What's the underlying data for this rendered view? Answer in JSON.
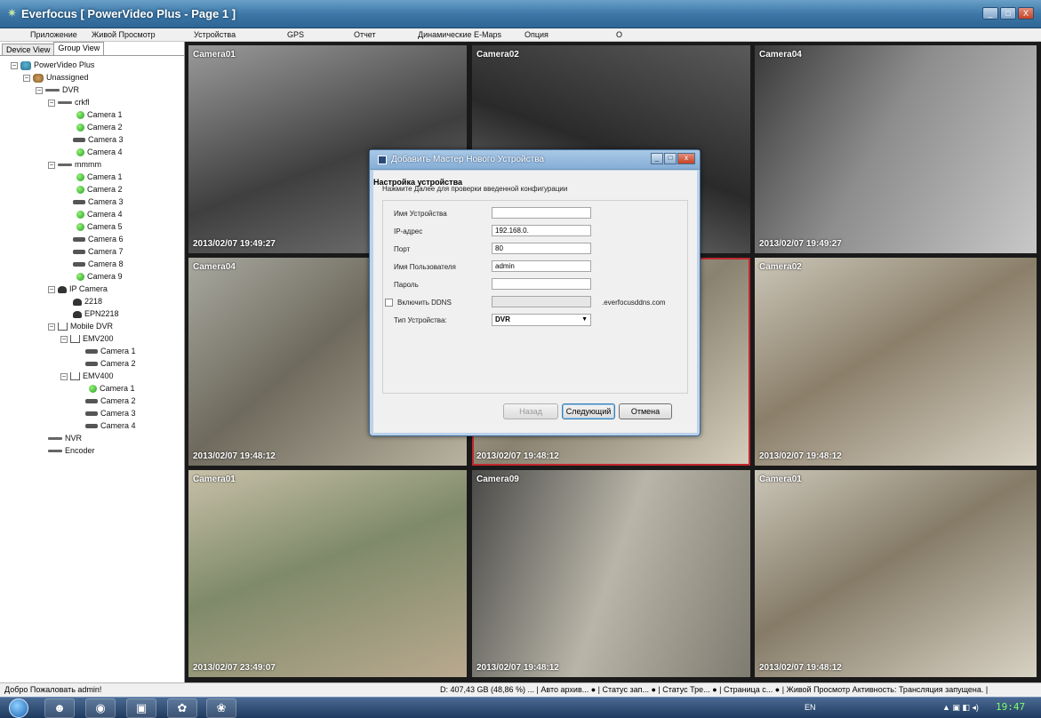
{
  "window": {
    "title": "Everfocus  [ PowerVideo Plus - Page 1 ]",
    "controls": [
      "_",
      "□",
      "X"
    ]
  },
  "menu": [
    "Приложение",
    "Живой Просмотр",
    "Устройства",
    "GPS",
    "Отчет",
    "Динамические E-Maps",
    "Опция",
    "О"
  ],
  "left_panel": {
    "tabs": [
      "Device View",
      "Group View"
    ],
    "active_tab": "Group View",
    "tree": {
      "root": "PowerVideo Plus",
      "unassigned": "Unassigned",
      "dvr": "DVR",
      "dvr1": "crkfl",
      "dvr1_cams": [
        "Camera 1",
        "Camera 2",
        "Camera 3",
        "Camera 4"
      ],
      "dvr2": "mmmm",
      "dvr2_cams": [
        "Camera 1",
        "Camera 2",
        "Camera 3",
        "Camera 4",
        "Camera 5",
        "Camera 6",
        "Camera 7",
        "Camera 8",
        "Camera 9"
      ],
      "ipcam": "IP Camera",
      "ipcams": [
        "2218",
        "EPN2218"
      ],
      "mobile": "Mobile DVR",
      "emv200": "EMV200",
      "emv200_cams": [
        "Camera 1",
        "Camera 2"
      ],
      "emv400": "EMV400",
      "emv400_cams": [
        "Camera 1",
        "Camera 2",
        "Camera 3",
        "Camera 4"
      ],
      "nvr": "NVR",
      "encoder": "Encoder"
    }
  },
  "cameras": [
    {
      "label": "Camera01",
      "timestamp": "2013/02/07  19:49:27"
    },
    {
      "label": "Camera02",
      "timestamp": ""
    },
    {
      "label": "Camera04",
      "timestamp": "2013/02/07  19:49:27"
    },
    {
      "label": "Camera04",
      "timestamp": "2013/02/07  19:48:12"
    },
    {
      "label": "",
      "timestamp": "2013/02/07  19:48:12"
    },
    {
      "label": "Camera02",
      "timestamp": "2013/02/07  19:48:12"
    },
    {
      "label": "Camera01",
      "timestamp": "2013/02/07  23:49:07"
    },
    {
      "label": "Camera09",
      "timestamp": "2013/02/07  19:48:12"
    },
    {
      "label": "Camera01",
      "timestamp": "2013/02/07  19:48:12"
    }
  ],
  "dialog": {
    "title": "Добавить Мастер Нового Устройства",
    "heading": "Настройка устройства",
    "subheading": "Нажмите Далее для проверки введенной конфигурации",
    "fields": {
      "device_name_label": "Имя Устройства",
      "device_name_value": "",
      "ip_label": "IP-адрес",
      "ip_value": "192.168.0.",
      "port_label": "Порт",
      "port_value": "80",
      "user_label": "Имя Пользователя",
      "user_value": "admin",
      "password_label": "Пароль",
      "password_value": "",
      "ddns_label": "Включить DDNS",
      "ddns_value": "",
      "ddns_suffix": ".everfocusddns.com",
      "type_label": "Тип Устройства:",
      "type_value": "DVR"
    },
    "buttons": {
      "back": "Назад",
      "next": "Следующий",
      "cancel": "Отмена"
    }
  },
  "status": {
    "left": "Добро Пожаловать admin!",
    "right": "D: 407,43 GB (48,86 %) ... | Авто архив... ● | Статус зап... ● | Статус Тре... ● | Страница с... ● |  Живой Просмотр  Активность: Трансляция запущена. |"
  },
  "taskbar": {
    "lang": "EN",
    "clock": "19:47"
  }
}
